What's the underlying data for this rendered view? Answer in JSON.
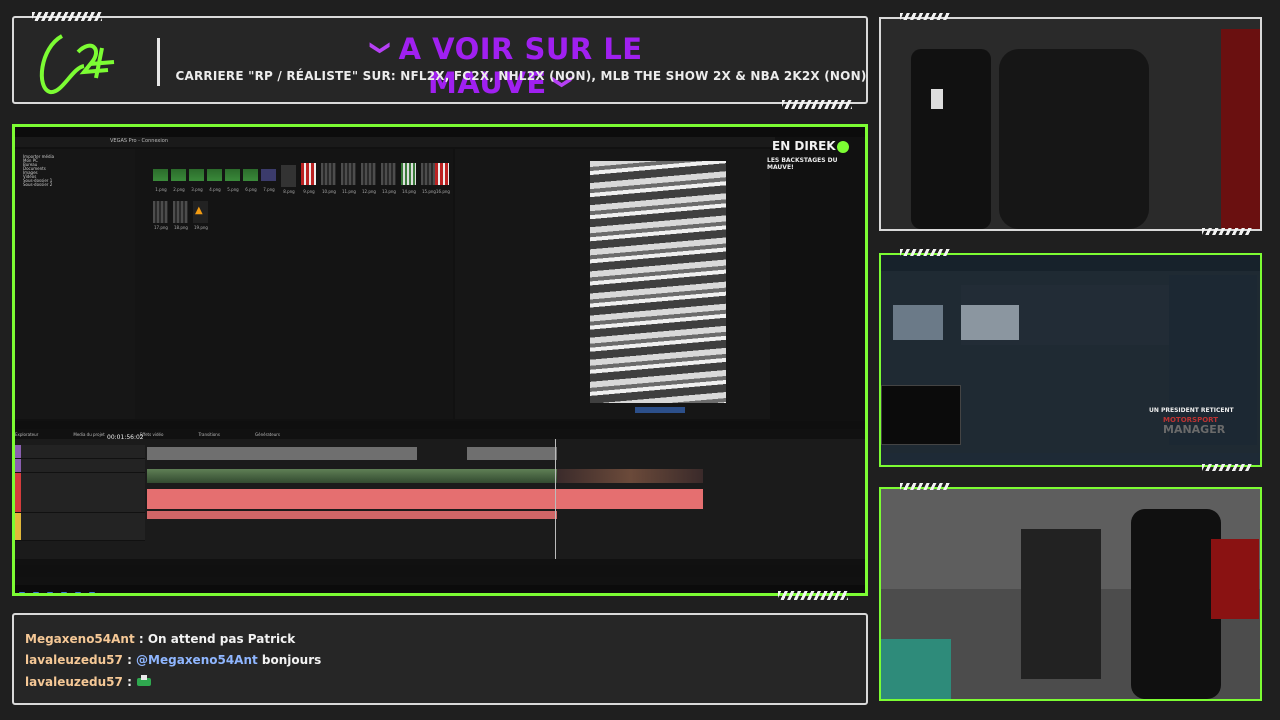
{
  "header": {
    "title": "A VOIR SUR LE MAUVE",
    "subtitle": "CARRIERE \"RP / RÉALISTE\" SUR: NFL2X, FC2X, NHL2X (NON), MLB THE SHOW 2X & NBA 2K2X (NON)",
    "chevron": "❯"
  },
  "main": {
    "live_badge": "EN DIREK",
    "live_sub": "LES BACKSTAGES DU MAUVE!",
    "app_title": "VEGAS Pro - Connexion",
    "timecode": "00:01:56:02",
    "menu": [
      "Fichier",
      "Edition",
      "Affichage",
      "Insérer",
      "Outils",
      "Options",
      "Aide"
    ],
    "tabs": [
      "Explorateur",
      "Media du projet",
      "Effets vidéo",
      "Transitions",
      "Générateurs"
    ],
    "tree": [
      "Importer média",
      "Mon PC",
      "Bureau",
      "Documents",
      "Images",
      "Vidéos",
      "Sous-dossier 1",
      "Sous-dossier 2"
    ],
    "media_labels": [
      "1.png",
      "2.png",
      "3.png",
      "4.png",
      "5.png",
      "6.png",
      "7.png",
      "8.png",
      "9.png",
      "10.png",
      "11.png",
      "12.png",
      "13.png",
      "14.png",
      "15.png",
      "16.png",
      "17.png",
      "18.png",
      "19.png"
    ]
  },
  "chat": [
    {
      "user": "Megaxeno54Ant",
      "sep": " : ",
      "mention": "",
      "message": "On attend pas Patrick"
    },
    {
      "user": "lavaleuzedu57",
      "sep": " : ",
      "mention": "@Megaxeno54Ant",
      "message": " bonjours"
    },
    {
      "user": "lavaleuzedu57",
      "sep": " : ",
      "mention": "",
      "message": ""
    }
  ],
  "cam2": {
    "caption": "UN PRESIDENT RETICENT",
    "brand_1": "MOTORSPORT",
    "brand_2": "MANAGER"
  },
  "colors": {
    "accent_green": "#7cfc33",
    "accent_purple": "#a020f0"
  }
}
